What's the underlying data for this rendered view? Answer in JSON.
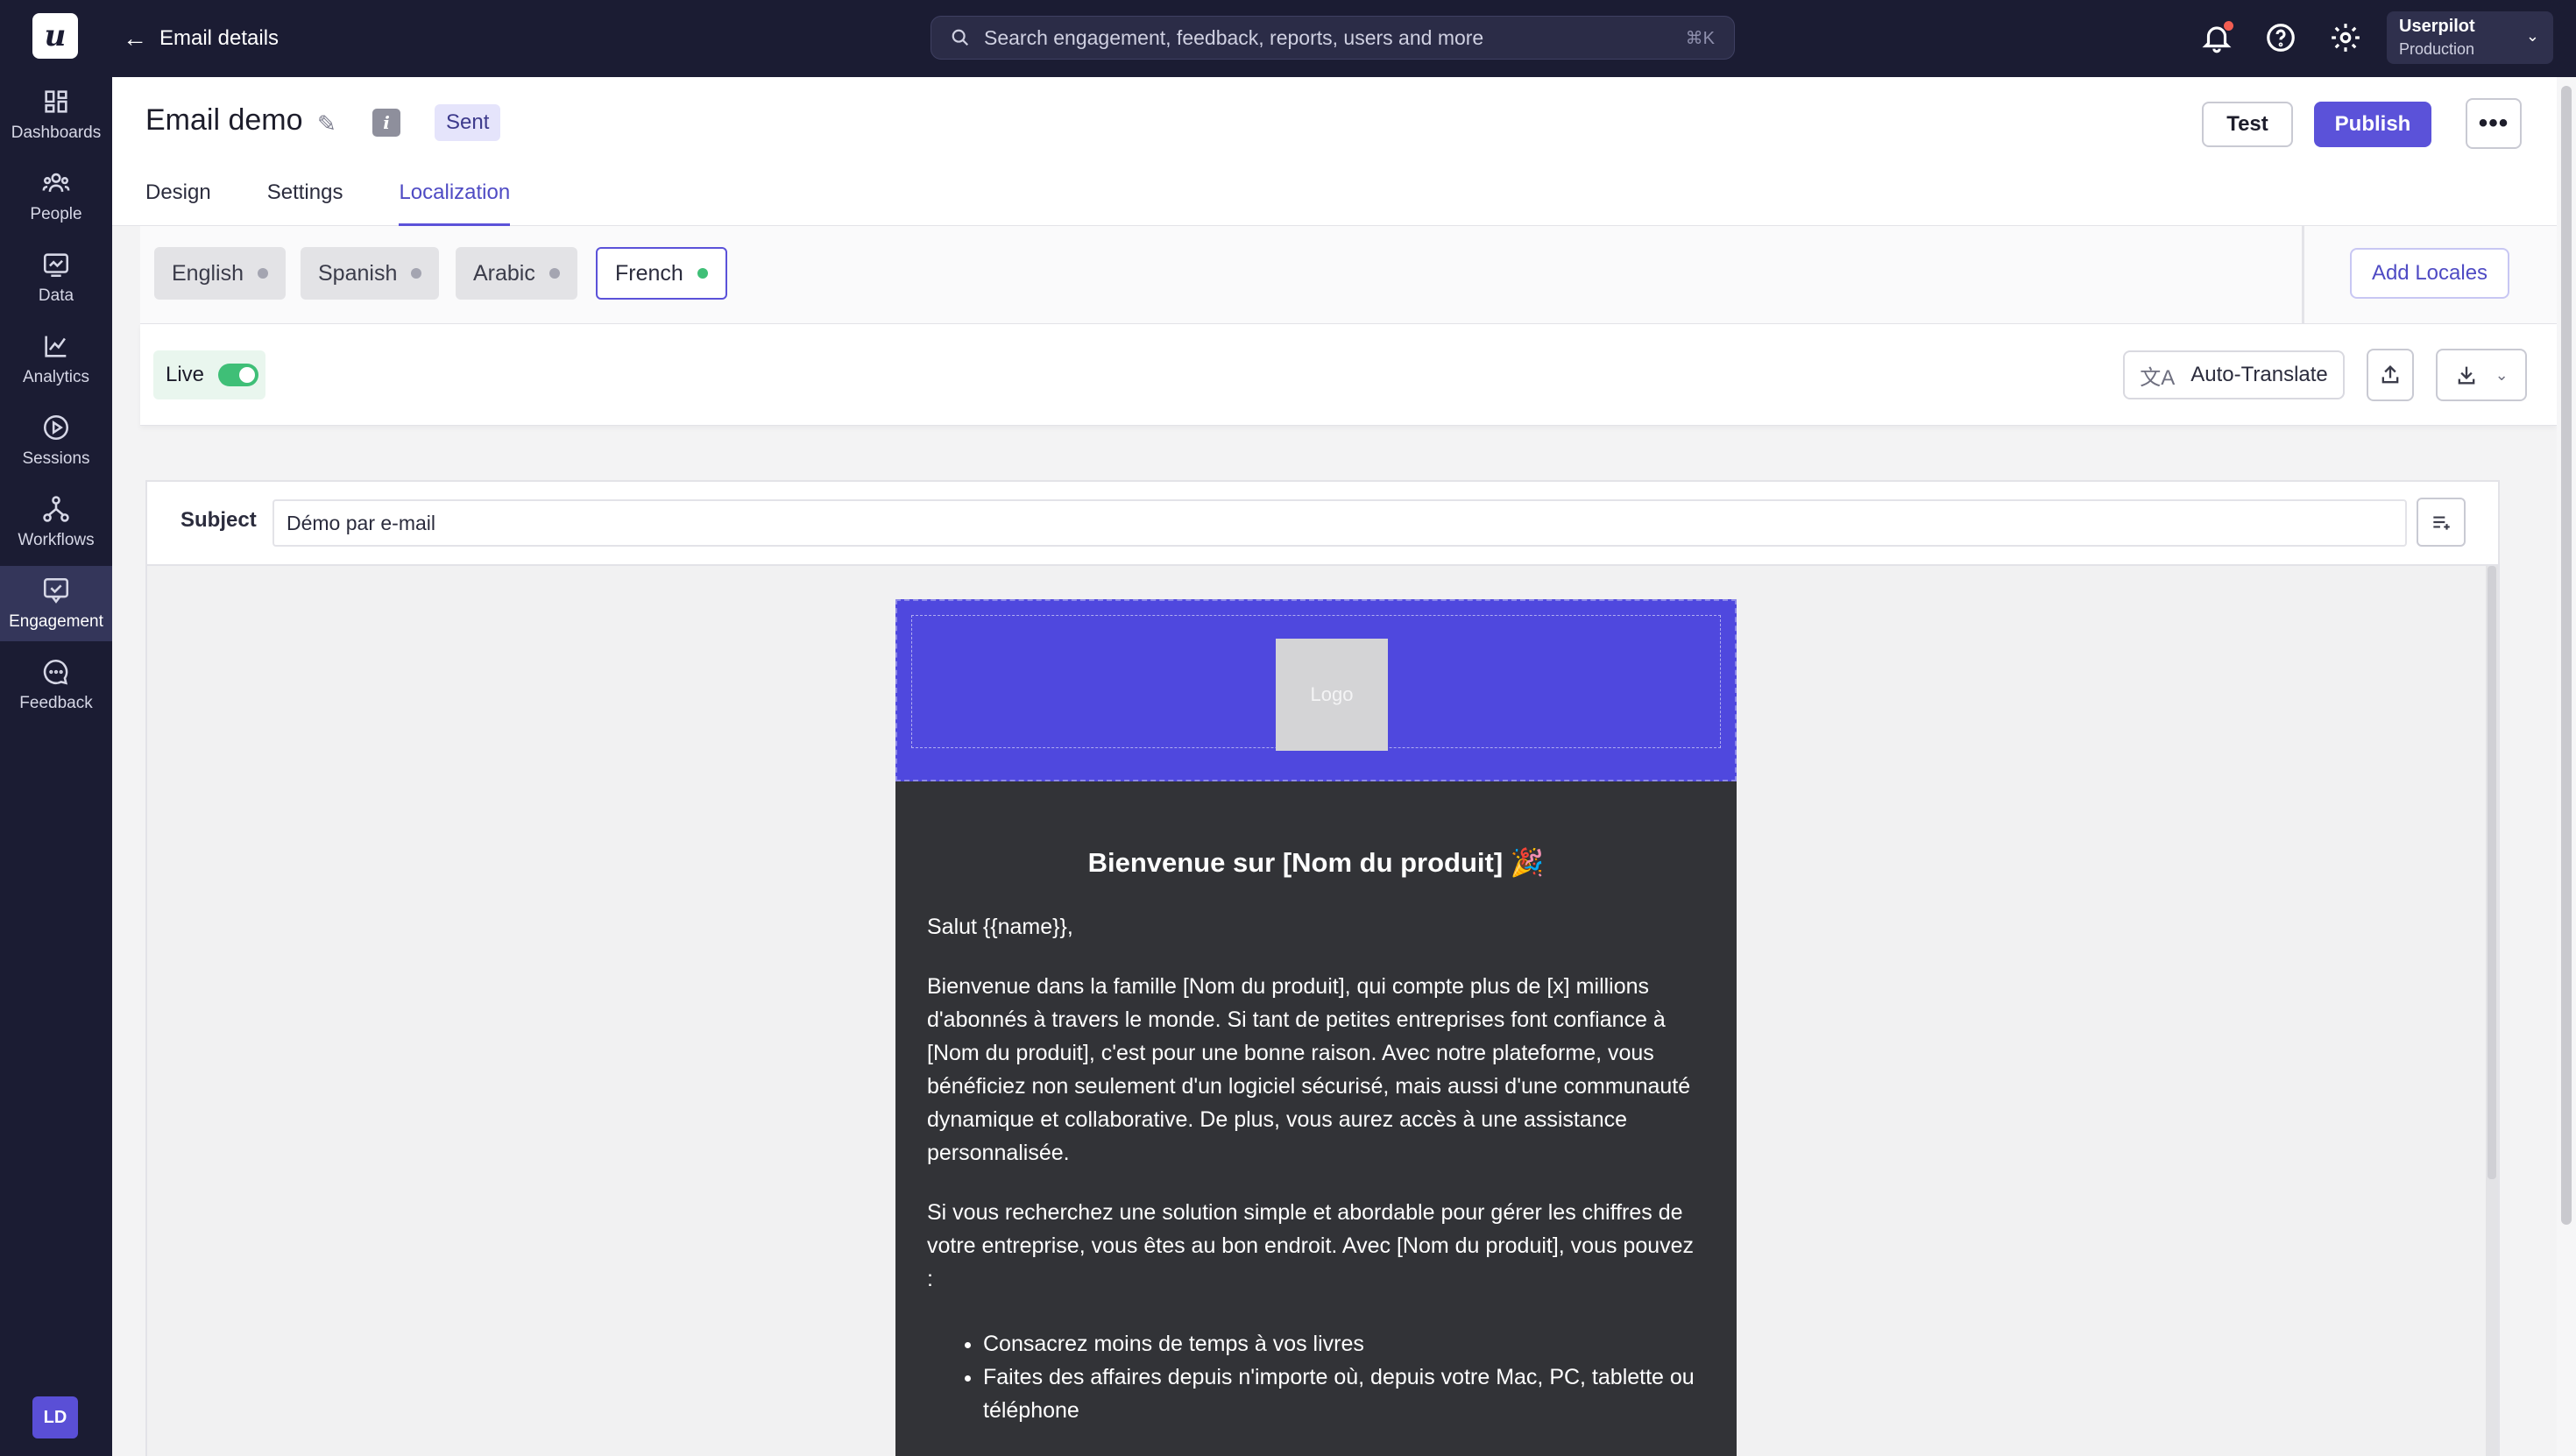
{
  "sidebar": {
    "logo": "u",
    "items": [
      {
        "label": "Dashboards",
        "icon": "dashboard-icon"
      },
      {
        "label": "People",
        "icon": "people-icon"
      },
      {
        "label": "Data",
        "icon": "data-icon"
      },
      {
        "label": "Analytics",
        "icon": "analytics-icon"
      },
      {
        "label": "Sessions",
        "icon": "sessions-icon"
      },
      {
        "label": "Workflows",
        "icon": "workflows-icon"
      },
      {
        "label": "Engagement",
        "icon": "engagement-icon",
        "active": true
      },
      {
        "label": "Feedback",
        "icon": "feedback-icon"
      }
    ],
    "avatar": "LD"
  },
  "topbar": {
    "back_label": "Email details",
    "search_placeholder": "Search engagement, feedback, reports, users and more",
    "search_shortcut": "⌘K",
    "account_name": "Userpilot",
    "account_env": "Production"
  },
  "header": {
    "title": "Email demo",
    "status": "Sent",
    "test_label": "Test",
    "publish_label": "Publish",
    "more_label": "•••",
    "tabs": [
      "Design",
      "Settings",
      "Localization"
    ],
    "active_tab": "Localization"
  },
  "locales": {
    "items": [
      "English",
      "Spanish",
      "Arabic",
      "French"
    ],
    "active": "French",
    "add_label": "Add Locales"
  },
  "toolbar": {
    "live_label": "Live",
    "live_on": true,
    "auto_translate_label": "Auto-Translate"
  },
  "editor": {
    "subject_label": "Subject",
    "subject_value": "Démo par e-mail"
  },
  "email": {
    "logo_placeholder": "Logo",
    "title": "Bienvenue sur [Nom du produit] 🎉",
    "greeting": "Salut {{name}},",
    "paragraph1": "Bienvenue dans la famille [Nom du produit], qui compte plus de [x] millions d'abonnés à travers le monde. Si tant de petites entreprises font confiance à [Nom du produit], c'est pour une bonne raison. Avec notre plateforme, vous bénéficiez non seulement d'un logiciel sécurisé, mais aussi d'une communauté dynamique et collaborative. De plus, vous aurez accès à une assistance personnalisée.",
    "paragraph2": "Si vous recherchez une solution simple et abordable pour gérer les chiffres de votre entreprise, vous êtes au bon endroit. Avec [Nom du produit], vous pouvez :",
    "bullets": [
      "Consacrez moins de temps à vos livres",
      "Faites des affaires depuis n'importe où, depuis votre Mac, PC, tablette ou téléphone"
    ]
  },
  "colors": {
    "sidebar_bg": "#1b1c33",
    "accent": "#5b52d9",
    "email_header": "#4f48de",
    "email_body": "#323337",
    "live_green": "#3fbf77"
  }
}
